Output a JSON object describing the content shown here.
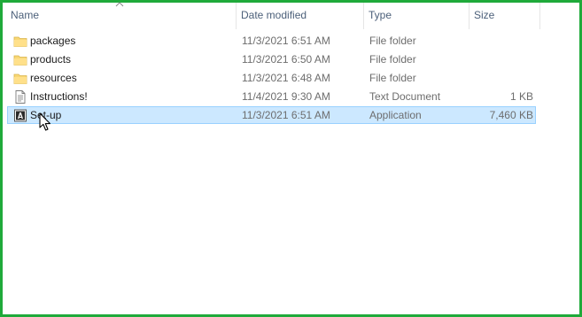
{
  "columns": {
    "name": "Name",
    "date": "Date modified",
    "type": "Type",
    "size": "Size"
  },
  "files": [
    {
      "name": "packages",
      "date": "11/3/2021 6:51 AM",
      "type": "File folder",
      "size": "",
      "icon": "folder-icon",
      "selected": false
    },
    {
      "name": "products",
      "date": "11/3/2021 6:50 AM",
      "type": "File folder",
      "size": "",
      "icon": "folder-icon",
      "selected": false
    },
    {
      "name": "resources",
      "date": "11/3/2021 6:48 AM",
      "type": "File folder",
      "size": "",
      "icon": "folder-icon",
      "selected": false
    },
    {
      "name": "Instructions!",
      "date": "11/4/2021 9:30 AM",
      "type": "Text Document",
      "size": "1 KB",
      "icon": "text-file-icon",
      "selected": false
    },
    {
      "name": "Set-up",
      "date": "11/3/2021 6:51 AM",
      "type": "Application",
      "size": "7,460 KB",
      "icon": "adobe-app-icon",
      "selected": true
    }
  ],
  "colors": {
    "border": "#1faa3a",
    "selection_fill": "#cce8ff",
    "selection_border": "#99d1ff",
    "header_text": "#4c607a",
    "muted_text": "#6d6d6d",
    "folder": "#f8d775"
  }
}
